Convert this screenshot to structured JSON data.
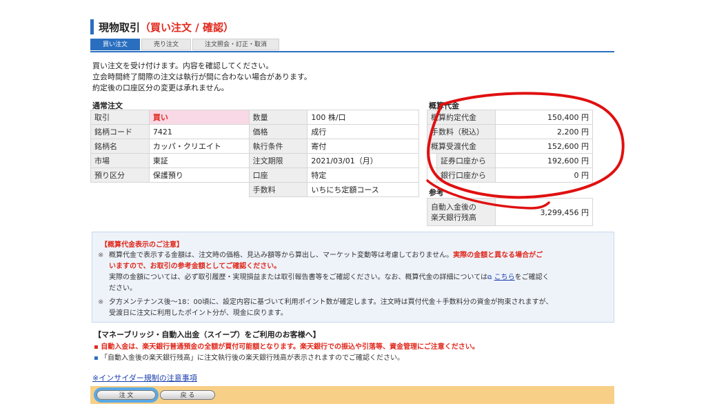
{
  "page": {
    "title_main": "現物取引",
    "title_sub": "（買い注文 / 確認）"
  },
  "tabs": [
    {
      "label": "買い注文",
      "active": true
    },
    {
      "label": "売り注文",
      "active": false
    },
    {
      "label": "注文照会・訂正・取消",
      "active": false
    }
  ],
  "intro": [
    "買い注文を受け付けます。内容を確認してください。",
    "立会時間終了間際の注文は執行が間に合わない場合があります。",
    "約定後の口座区分の変更は承れません。"
  ],
  "order": {
    "heading": "通常注文",
    "rows": [
      {
        "l1": "取引",
        "v1": "買い",
        "l2": "数量",
        "v2": "100 株/口"
      },
      {
        "l1": "銘柄コード",
        "v1": "7421",
        "l2": "価格",
        "v2": "成行"
      },
      {
        "l1": "銘柄名",
        "v1": "カッパ・クリエイト",
        "l2": "執行条件",
        "v2": "寄付"
      },
      {
        "l1": "市場",
        "v1": "東証",
        "l2": "注文期限",
        "v2": "2021/03/01（月）"
      },
      {
        "l1": "預り区分",
        "v1": "保護預り",
        "l2": "口座",
        "v2": "特定"
      }
    ],
    "fee_label": "手数料",
    "fee_value": "いちにち定額コース"
  },
  "estimate": {
    "heading": "概算代金",
    "rows": [
      {
        "label": "概算約定代金",
        "value": "150,400 円"
      },
      {
        "label": "手数料（税込）",
        "value": "2,200 円"
      },
      {
        "label": "概算受渡代金",
        "value": "152,600 円"
      }
    ],
    "sub_rows": [
      {
        "label": "証券口座から",
        "value": "192,600 円"
      },
      {
        "label": "銀行口座から",
        "value": "0 円"
      }
    ]
  },
  "reference": {
    "heading": "参考",
    "label_line1": "自動入金後の",
    "label_line2": "楽天銀行残高",
    "value": "3,299,456 円"
  },
  "notice": {
    "heading": "【概算代金表示のご注意】",
    "mark": "※",
    "p1_a": "概算代金で表示する金額は、注文時の価格、見込み額等から算出し、マーケット変動等は考慮しておりません。",
    "p1_b": "実際の金額と異なる場合がご",
    "p1_c": "いますので、お取引の参考金額としてご確認ください。",
    "p2_a": "実際の金額については、必ず取引履歴・実現損益または取引報告書等をご確認ください。なお、概算代金の詳細については",
    "p2_link": "こちら",
    "p2_b": "をご確認く",
    "p2_c": "ださい。",
    "p3_a": "夕方メンテナンス後〜18：00頃に、設定内容に基づいて利用ポイント数が確定します。注文時は買付代金＋手数料分の資金が拘束されますが、",
    "p3_b": "受渡日に注文に利用したポイント分が、現金に戻ります。"
  },
  "sweep": {
    "heading": "【マネーブリッジ・自動入出金（スイープ）をご利用のお客様へ】",
    "line1": "自動入金は、楽天銀行普通預金の全額が買付可能額となります。楽天銀行での振込や引落等、資金管理にご注意ください。",
    "line2": "「自動入金後の楽天銀行残高」に注文執行後の楽天銀行残高が表示されますのでご確認ください。"
  },
  "insider_link": "※インサイダー規制の注意事項",
  "buttons": {
    "order": "注 文",
    "back": "戻 る"
  },
  "colors": {
    "accent_blue": "#2a6fbf",
    "warning_red": "#e0281c",
    "annotation_red": "#e01010",
    "footer_bar": "#f7cf86"
  }
}
